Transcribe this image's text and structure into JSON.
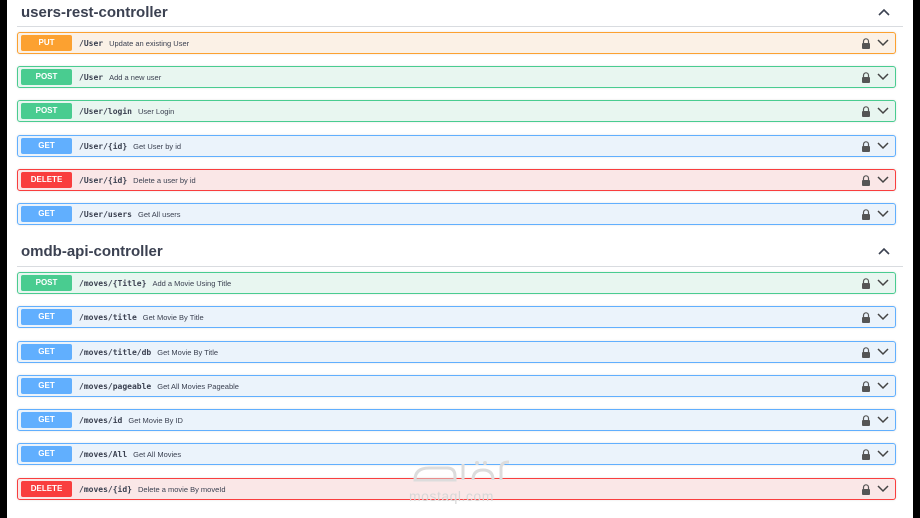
{
  "sections": [
    {
      "title": "users-rest-controller",
      "operations": [
        {
          "method": "PUT",
          "path": "/User",
          "summary": "Update an existing User"
        },
        {
          "method": "POST",
          "path": "/User",
          "summary": "Add a new user"
        },
        {
          "method": "POST",
          "path": "/User/login",
          "summary": "User Login"
        },
        {
          "method": "GET",
          "path": "/User/{id}",
          "summary": "Get User by id"
        },
        {
          "method": "DELETE",
          "path": "/User/{id}",
          "summary": "Delete a user by id"
        },
        {
          "method": "GET",
          "path": "/User/users",
          "summary": "Get All users"
        }
      ]
    },
    {
      "title": "omdb-api-controller",
      "operations": [
        {
          "method": "POST",
          "path": "/moves/{Title}",
          "summary": "Add a Movie Using Title"
        },
        {
          "method": "GET",
          "path": "/moves/title",
          "summary": "Get Movie By Title"
        },
        {
          "method": "GET",
          "path": "/moves/title/db",
          "summary": "Get Movie By Title"
        },
        {
          "method": "GET",
          "path": "/moves/pageable",
          "summary": "Get All Movies Pageable"
        },
        {
          "method": "GET",
          "path": "/moves/id",
          "summary": "Get Movie By ID"
        },
        {
          "method": "GET",
          "path": "/moves/All",
          "summary": "Get All Movies"
        },
        {
          "method": "DELETE",
          "path": "/moves/{id}",
          "summary": "Delete a movie By moveId"
        }
      ]
    }
  ],
  "colors": {
    "put": "#fca130",
    "post": "#49cc90",
    "get": "#61affe",
    "delete": "#f93e3e"
  },
  "icons": {
    "section_toggle": "chevron-up-icon",
    "op_lock": "lock-icon",
    "op_expand": "chevron-down-icon"
  },
  "watermark": {
    "text": "mostaql.com"
  }
}
